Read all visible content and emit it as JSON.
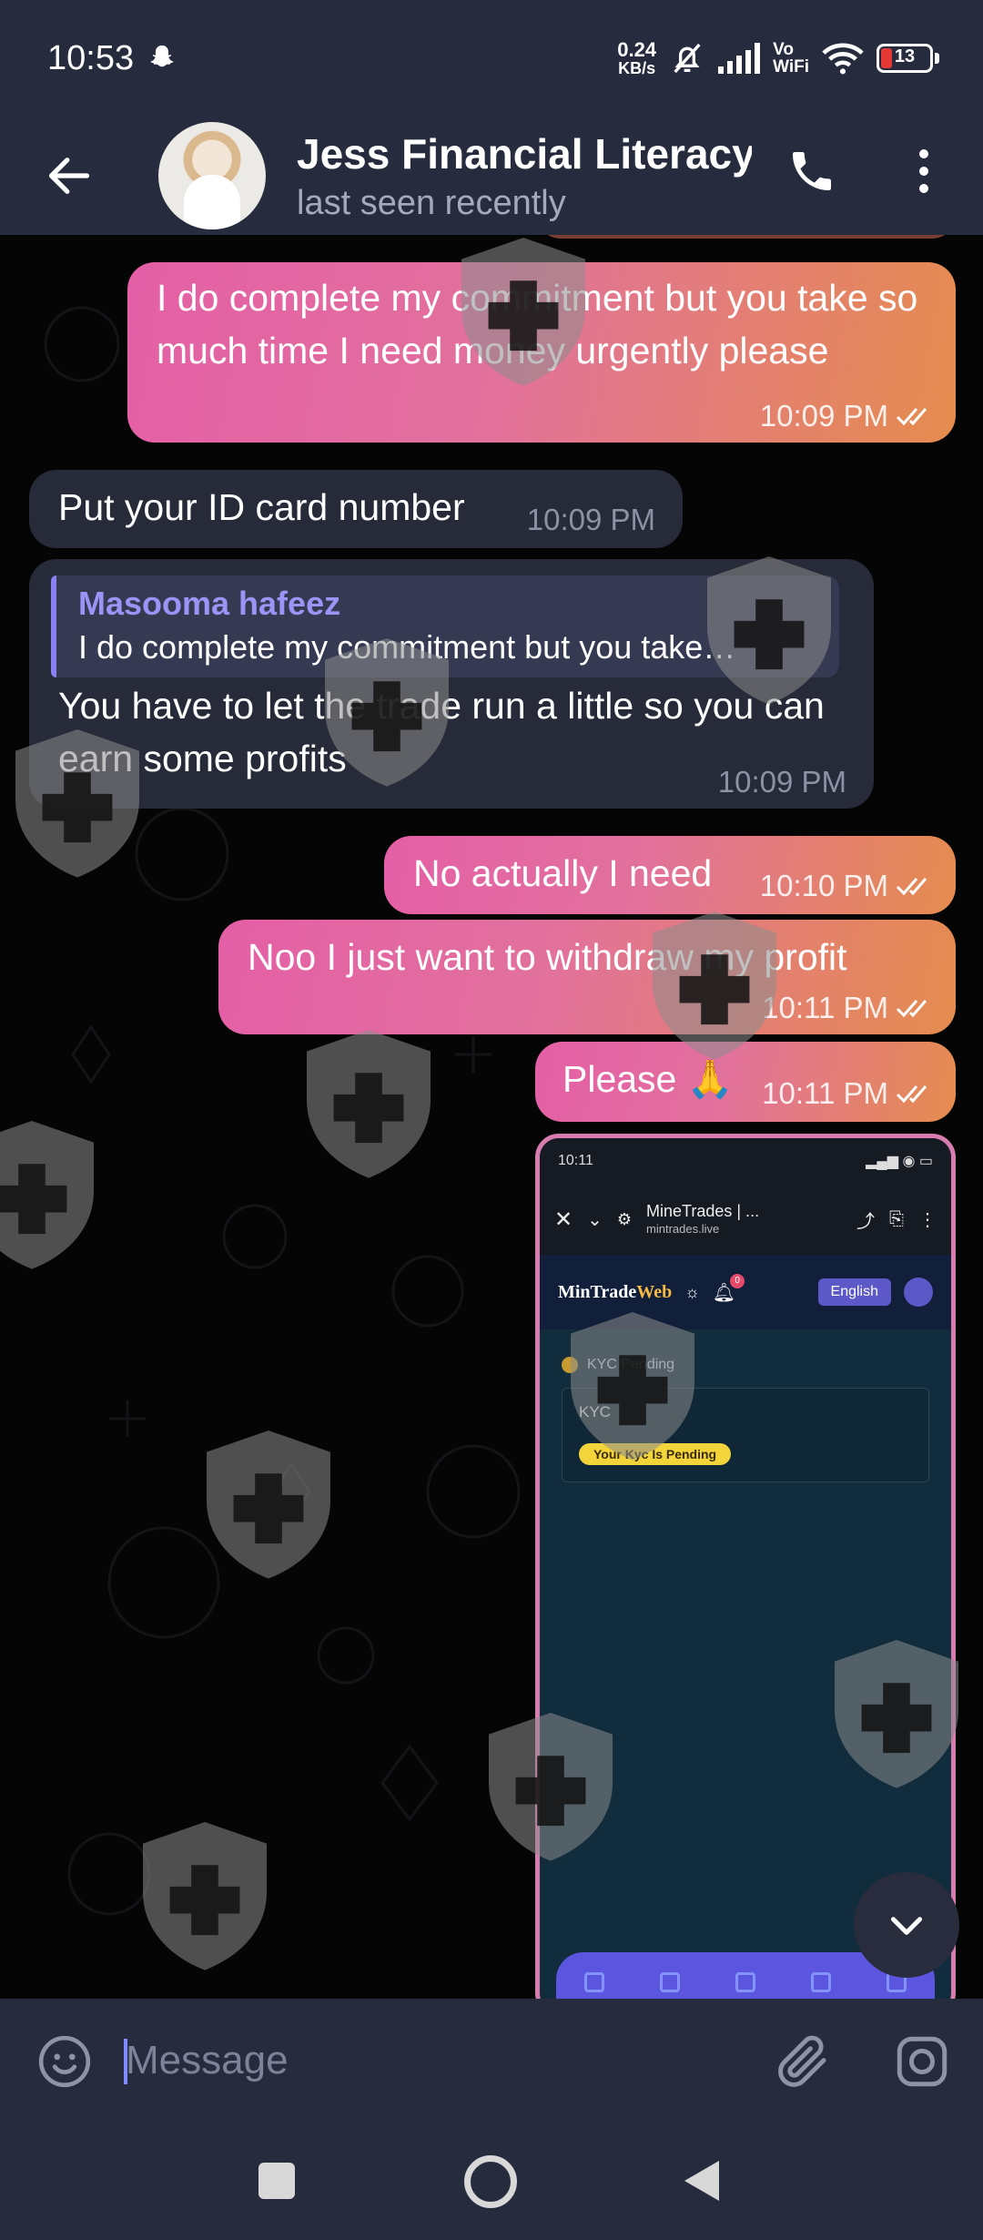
{
  "status_bar": {
    "time": "10:53",
    "net_speed_value": "0.24",
    "net_speed_unit": "KB/s",
    "vowifi_top": "Vo",
    "vowifi_bottom": "WiFi",
    "battery": "13"
  },
  "header": {
    "name": "Jess Financial Literacy",
    "status": "last seen recently"
  },
  "messages": [
    {
      "text": "I do complete my commitment but you take so much time I need money urgently please",
      "time": "10:09 PM"
    },
    {
      "text": "Put your ID card number",
      "time": "10:09 PM"
    },
    {
      "reply_author": "Masooma hafeez",
      "reply_text": "I do complete my commitment but you take…",
      "text": "You have to let the trade run a little so you can earn some profits",
      "time": "10:09 PM"
    },
    {
      "text": "No actually I need",
      "time": "10:10 PM"
    },
    {
      "text": "Noo I just want to withdraw my profit",
      "time": "10:11 PM"
    },
    {
      "text": "Please 🙏",
      "time": "10:11 PM"
    }
  ],
  "screenshot": {
    "status_time": "10:11",
    "page_title": "MineTrades | ...",
    "page_url": "mintrades.live",
    "logo_main": "MinTrade",
    "logo_accent": "Web",
    "notification_count": "0",
    "language": "English",
    "kyc_pending": "KYC Pending",
    "kyc_title": "KYC",
    "kyc_badge": "Your Kyc Is Pending"
  },
  "input": {
    "placeholder": "Message"
  },
  "colors": {
    "bar": "#262b3d",
    "incoming": "#272a38",
    "outgoing_start": "#e45fa6",
    "outgoing_end": "#e58c4e",
    "reply_accent": "#9d93f7"
  }
}
